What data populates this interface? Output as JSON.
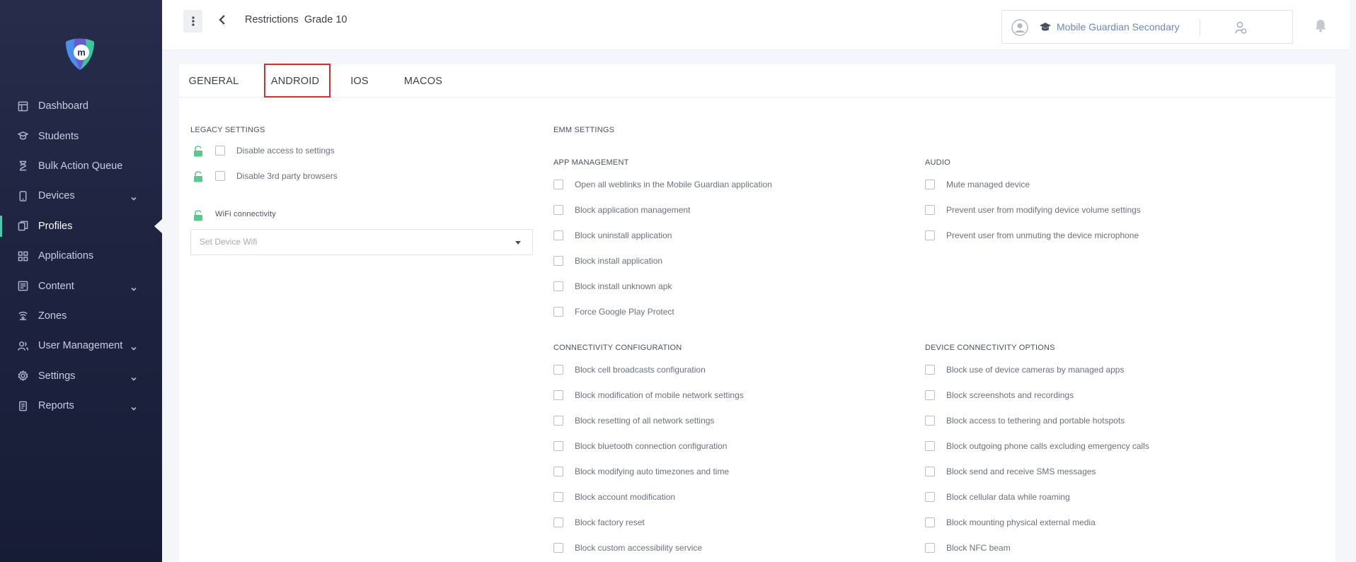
{
  "sidebar": {
    "items": [
      {
        "label": "Dashboard",
        "icon": "dashboard-icon",
        "has_submenu": false
      },
      {
        "label": "Students",
        "icon": "students-icon",
        "has_submenu": false
      },
      {
        "label": "Bulk Action Queue",
        "icon": "hourglass-icon",
        "has_submenu": false
      },
      {
        "label": "Devices",
        "icon": "device-icon",
        "has_submenu": true
      },
      {
        "label": "Profiles",
        "icon": "profiles-icon",
        "has_submenu": false,
        "active": true
      },
      {
        "label": "Applications",
        "icon": "apps-grid-icon",
        "has_submenu": false
      },
      {
        "label": "Content",
        "icon": "content-icon",
        "has_submenu": true
      },
      {
        "label": "Zones",
        "icon": "zones-icon",
        "has_submenu": false
      },
      {
        "label": "User Management",
        "icon": "users-icon",
        "has_submenu": true
      },
      {
        "label": "Settings",
        "icon": "gear-icon",
        "has_submenu": true
      },
      {
        "label": "Reports",
        "icon": "reports-icon",
        "has_submenu": true
      }
    ]
  },
  "header": {
    "breadcrumb": [
      "Restrictions",
      "Grade 10"
    ],
    "account_name": "Mobile Guardian Secondary"
  },
  "tabs": [
    {
      "label": "GENERAL"
    },
    {
      "label": "ANDROID",
      "active": true
    },
    {
      "label": "IOS"
    },
    {
      "label": "MACOS"
    }
  ],
  "legacy": {
    "title": "LEGACY SETTINGS",
    "options": [
      "Disable access to settings",
      "Disable 3rd party browsers"
    ],
    "wifi_label": "WiFi connectivity",
    "wifi_placeholder": "Set Device Wifi"
  },
  "emm": {
    "title": "EMM SETTINGS",
    "app_management": {
      "title": "APP MANAGEMENT",
      "options": [
        "Open all weblinks in the Mobile Guardian application",
        "Block application management",
        "Block uninstall application",
        "Block install application",
        "Block install unknown apk",
        "Force Google Play Protect"
      ]
    },
    "audio": {
      "title": "AUDIO",
      "options": [
        "Mute managed device",
        "Prevent user from modifying device volume settings",
        "Prevent user from unmuting the device microphone"
      ]
    },
    "connectivity": {
      "title": "CONNECTIVITY CONFIGURATION",
      "options": [
        "Block cell broadcasts configuration",
        "Block modification of mobile network settings",
        "Block resetting of all network settings",
        "Block bluetooth connection configuration",
        "Block modifying auto timezones and time",
        "Block account modification",
        "Block factory reset",
        "Block custom accessibility service"
      ]
    },
    "device_connectivity": {
      "title": "DEVICE CONNECTIVITY OPTIONS",
      "options": [
        "Block use of device cameras by managed apps",
        "Block screenshots and recordings",
        "Block access to tethering and portable hotspots",
        "Block outgoing phone calls excluding emergency calls",
        "Block send and receive SMS messages",
        "Block cellular data while roaming",
        "Block mounting physical external media",
        "Block NFC beam"
      ]
    }
  },
  "colors": {
    "sidebar_bg": "#1f2541",
    "active_indicator": "#4cc9b0",
    "account_text": "#6e87b8",
    "tab_highlight": "#e5282e",
    "lock_green": "#5cc98a"
  }
}
